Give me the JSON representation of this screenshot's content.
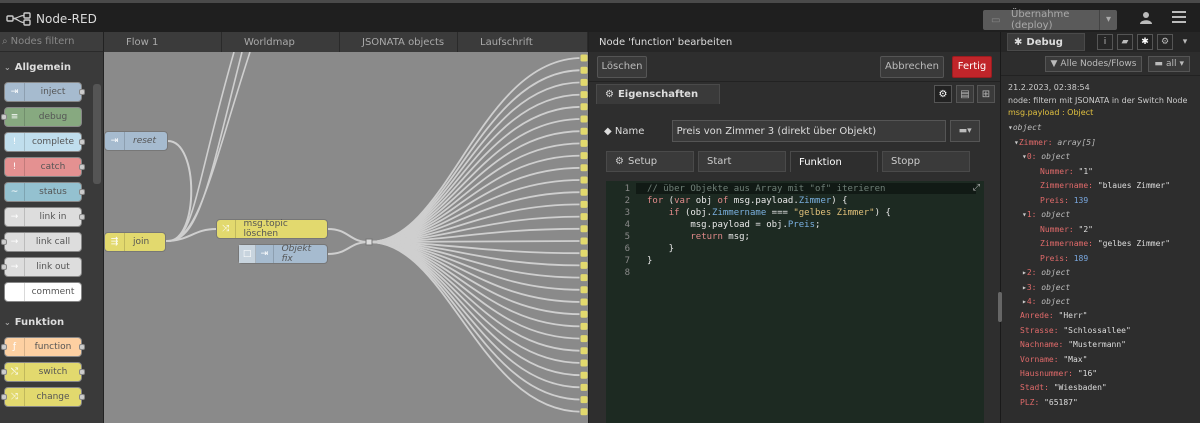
{
  "app": {
    "title": "Node-RED",
    "deploy_label": "Übernahme (deploy)"
  },
  "palette": {
    "filter_placeholder": "Nodes filtern",
    "categories": [
      "Allgemein",
      "Funktion"
    ],
    "nodes_allgemein": [
      "inject",
      "debug",
      "complete",
      "catch",
      "status",
      "link in",
      "link call",
      "link out",
      "comment"
    ],
    "nodes_funktion": [
      "function",
      "switch",
      "change"
    ]
  },
  "workspace": {
    "tabs": [
      "Flow 1",
      "Worldmap",
      "JSONATA objects",
      "Laufschrift"
    ],
    "nodes": {
      "reset": "reset",
      "join": "join",
      "topic": "msg.topic löschen",
      "objekt": "Objekt fix"
    }
  },
  "editor": {
    "title": "Node 'function' bearbeiten",
    "delete_label": "Löschen",
    "cancel_label": "Abbrechen",
    "done_label": "Fertig",
    "props_tab": "Eigenschaften",
    "name_label": "Name",
    "name_value": "Preis von Zimmer 3 (direkt über Objekt)",
    "func_tabs": [
      "Setup",
      "Start",
      "Funktion",
      "Stopp"
    ],
    "code_lines": [
      "// über Objekte aus Array mit \"of\" iterieren",
      "for (var obj of msg.payload.Zimmer) {",
      "    if (obj.Zimmername === \"gelbes Zimmer\") {",
      "        msg.payload = obj.Preis;",
      "        return msg;",
      "    }",
      "}",
      ""
    ]
  },
  "debug": {
    "tab_label": "Debug",
    "filter_label": "Alle Nodes/Flows",
    "clear_label": "all",
    "timestamp": "21.2.2023, 02:38:54",
    "source": "node: filtern mit JSONATA in der Switch Node",
    "path": "msg.payload : Object",
    "tree": {
      "root": "object",
      "zimmer_key": "Zimmer:",
      "zimmer_type": "array[5]",
      "item0_key": "0:",
      "item1_key": "1:",
      "item2_key": "2:",
      "item3_key": "3:",
      "item4_key": "4:",
      "object_type": "object",
      "nummer_key": "Nummer:",
      "zimmername_key": "Zimmername:",
      "preis_key": "Preis:",
      "item0_nummer": "\"1\"",
      "item0_zimmername": "\"blaues Zimmer\"",
      "item0_preis": "139",
      "item1_nummer": "\"2\"",
      "item1_zimmername": "\"gelbes Zimmer\"",
      "item1_preis": "189",
      "anrede_key": "Anrede:",
      "anrede_val": "\"Herr\"",
      "strasse_key": "Strasse:",
      "strasse_val": "\"Schlossallee\"",
      "nachname_key": "Nachname:",
      "nachname_val": "\"Mustermann\"",
      "vorname_key": "Vorname:",
      "vorname_val": "\"Max\"",
      "hausnummer_key": "Hausnummer:",
      "hausnummer_val": "\"16\"",
      "stadt_key": "Stadt:",
      "stadt_val": "\"Wiesbaden\"",
      "plz_key": "PLZ:",
      "plz_val": "\"65187\""
    }
  },
  "colors": {
    "accent": "#c0252a",
    "inject": "#a6bbcf",
    "debug": "#87a980",
    "function": "#fdd0a2",
    "switch": "#e2d96e",
    "topic": "#e2d96e",
    "join": "#e2d96e",
    "link": "#dddddd"
  }
}
